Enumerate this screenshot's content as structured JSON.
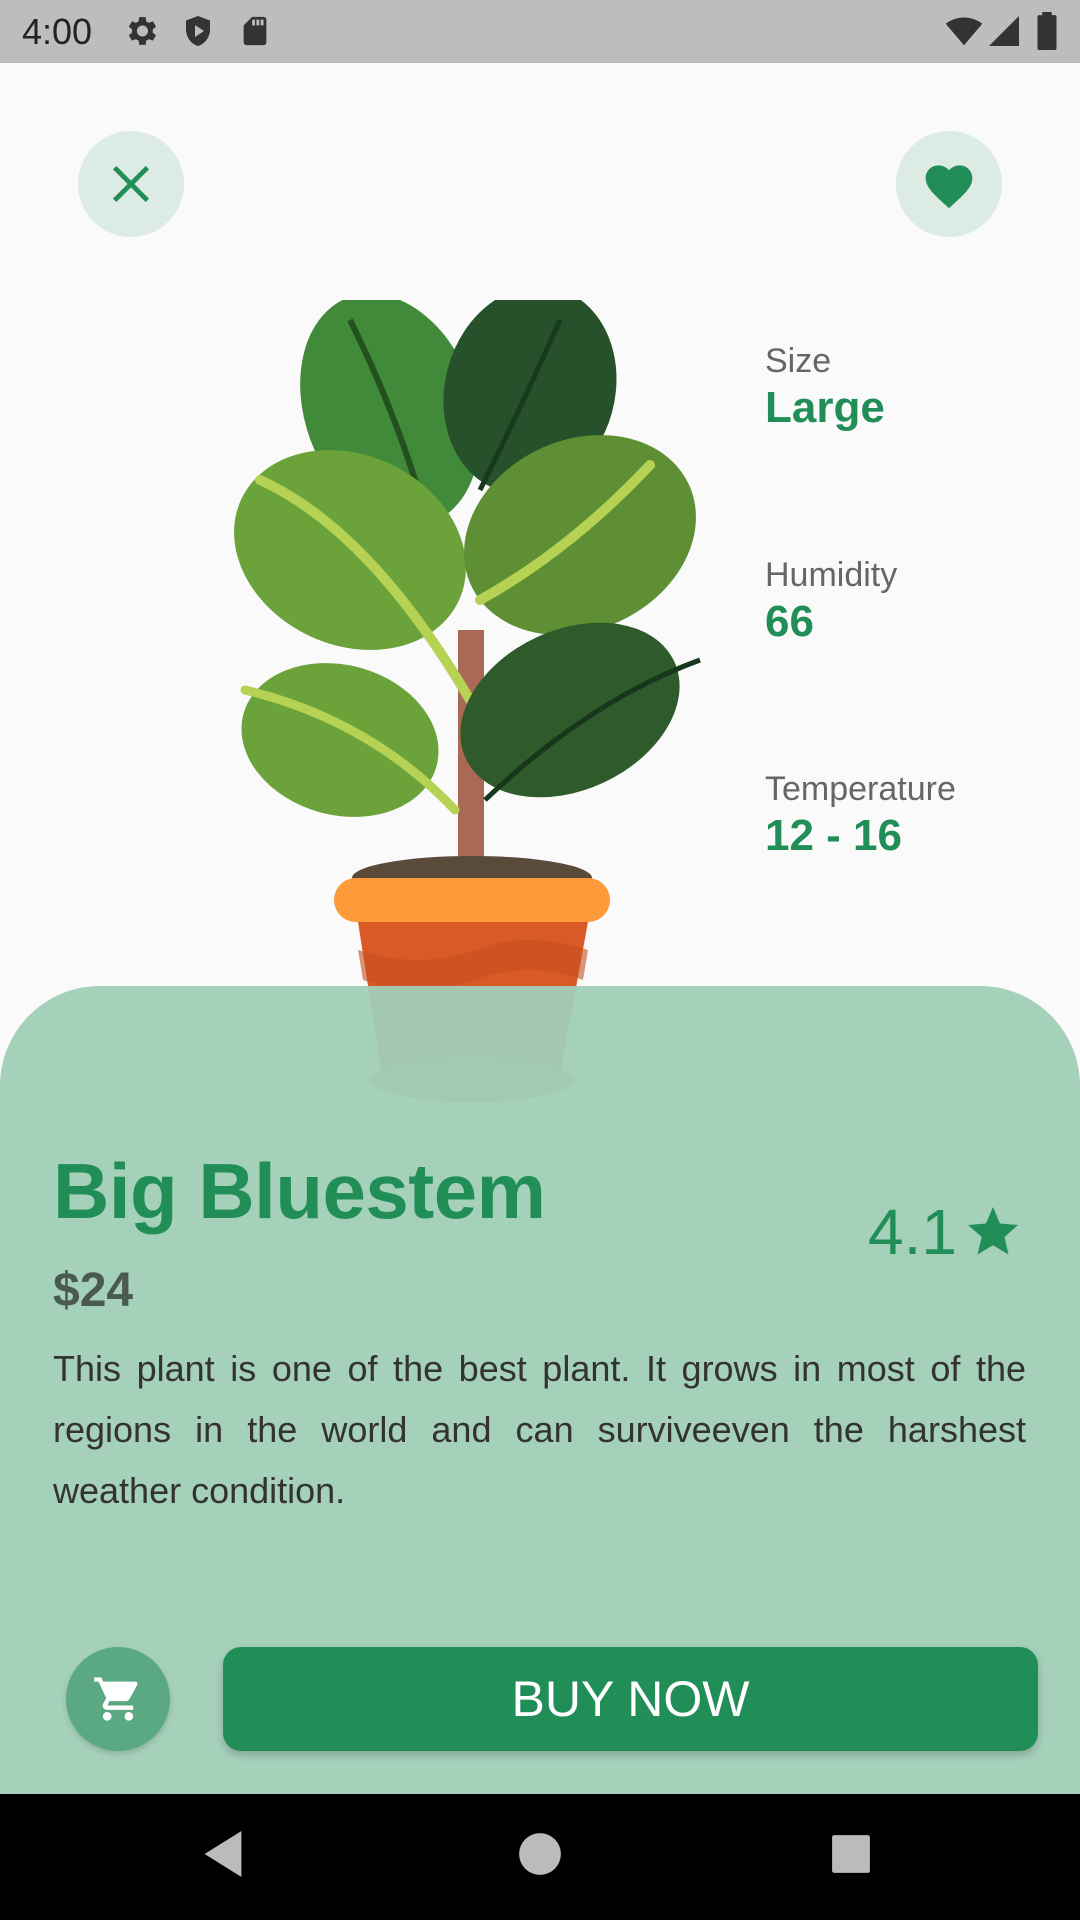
{
  "status_bar": {
    "time": "4:00",
    "icons": [
      "gear-icon",
      "shield-icon",
      "sd-card-icon",
      "wifi-icon",
      "signal-icon",
      "battery-icon"
    ]
  },
  "top_actions": {
    "close_icon": "close-icon",
    "favorite_icon": "heart-icon"
  },
  "specs": [
    {
      "label": "Size",
      "value": "Large"
    },
    {
      "label": "Humidity",
      "value": "66"
    },
    {
      "label": "Temperature",
      "value": "12 - 16"
    }
  ],
  "product": {
    "name": "Big Bluestem",
    "price": "$24",
    "rating": "4.1",
    "description": "This plant is one of the best plant. It grows in most of the regions in the world and can surviveeven the harshest weather condition."
  },
  "actions": {
    "cart_icon": "cart-icon",
    "buy_label": "BUY NOW"
  },
  "colors": {
    "accent": "#218e58",
    "sheet": "#a3cfb8",
    "button_bg": "#dcebe4"
  }
}
